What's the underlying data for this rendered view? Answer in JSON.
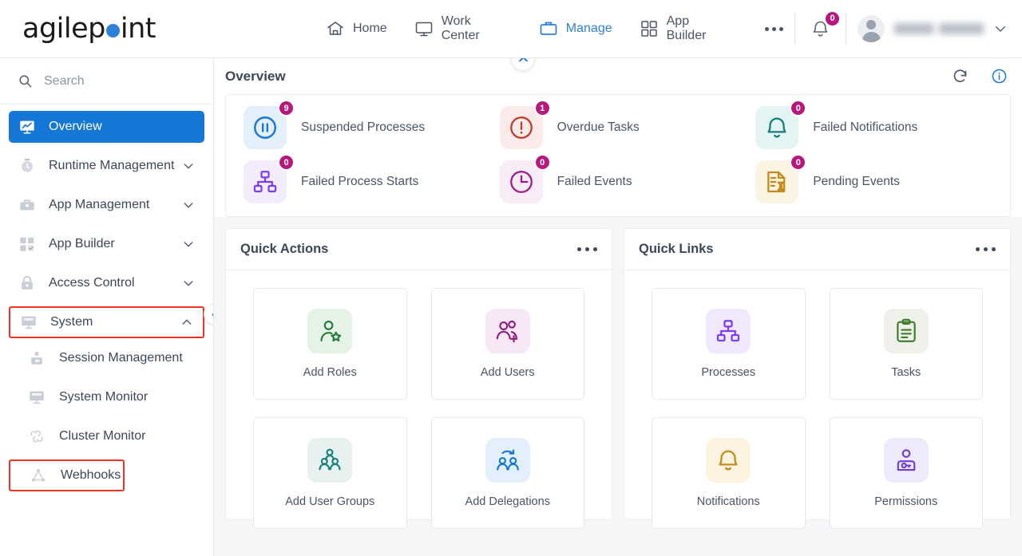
{
  "brand": {
    "name": "agilepoint",
    "dot_color": "#2f80d8"
  },
  "header": {
    "nav": [
      {
        "label": "Home",
        "icon": "home-icon",
        "active": false
      },
      {
        "label": "Work Center",
        "icon": "monitor-icon",
        "active": false
      },
      {
        "label": "Manage",
        "icon": "briefcase-icon",
        "active": true
      },
      {
        "label": "App Builder",
        "icon": "grid-icon",
        "active": false
      }
    ],
    "more_label": "...",
    "notifications": {
      "icon": "bell-icon",
      "count": "0",
      "badge_color": "#b5197c"
    },
    "user": {
      "name": "",
      "avatar": "user-avatar",
      "chevron": "chevron-down-icon"
    }
  },
  "sidebar": {
    "search": {
      "placeholder": "Search",
      "value": "",
      "icon": "search-icon"
    },
    "items": [
      {
        "label": "Overview",
        "icon": "overview-chart-icon",
        "state": "active",
        "expandable": false
      },
      {
        "label": "Runtime Management",
        "icon": "clock-icon",
        "state": "normal",
        "expandable": true,
        "chevron": "chevron-down-icon"
      },
      {
        "label": "App Management",
        "icon": "toolbox-icon",
        "state": "normal",
        "expandable": true,
        "chevron": "chevron-down-icon"
      },
      {
        "label": "App Builder",
        "icon": "grid-check-icon",
        "state": "normal",
        "expandable": true,
        "chevron": "chevron-down-icon"
      },
      {
        "label": "Access Control",
        "icon": "lock-icon",
        "state": "normal",
        "expandable": true,
        "chevron": "chevron-down-icon"
      },
      {
        "label": "System",
        "icon": "server-monitor-icon",
        "state": "highlighted",
        "expandable": true,
        "chevron": "chevron-up-icon"
      }
    ],
    "sub_items": [
      {
        "label": "Session Management",
        "icon": "user-session-icon",
        "highlighted": false
      },
      {
        "label": "System Monitor",
        "icon": "server-monitor-icon",
        "highlighted": false
      },
      {
        "label": "Cluster Monitor",
        "icon": "cluster-icon",
        "highlighted": false
      },
      {
        "label": "Webhooks",
        "icon": "webhook-icon",
        "highlighted": true
      }
    ],
    "highlight_color": "#ee3224",
    "collapse_handle": "chevron-left-icon"
  },
  "overview": {
    "title": "Overview",
    "collapse_icon": "chevron-up-icon",
    "refresh_icon": "refresh-icon",
    "info_icon": "info-icon",
    "stats": [
      {
        "label": "Suspended Processes",
        "count": "9",
        "icon": "pause-circle-icon",
        "color": "#1678d6",
        "bg": "#e3f0fc"
      },
      {
        "label": "Overdue Tasks",
        "count": "1",
        "icon": "alert-circle-icon",
        "color": "#c0392b",
        "bg": "#fbeaea"
      },
      {
        "label": "Failed Notifications",
        "count": "0",
        "icon": "bell-icon",
        "color": "#147d7d",
        "bg": "#e3f4f2"
      },
      {
        "label": "Failed Process Starts",
        "count": "0",
        "icon": "hierarchy-icon",
        "color": "#7b3ff2",
        "bg": "#f2ecfd"
      },
      {
        "label": "Failed Events",
        "count": "0",
        "icon": "clock-circle-icon",
        "color": "#a01a8d",
        "bg": "#f8ecf6"
      },
      {
        "label": "Pending Events",
        "count": "0",
        "icon": "pending-doc-icon",
        "color": "#c58a1a",
        "bg": "#fcf4e3"
      }
    ]
  },
  "quick_actions": {
    "title": "Quick Actions",
    "menu_icon": "more-dots-icon",
    "tiles": [
      {
        "label": "Add Roles",
        "icon": "user-star-icon",
        "color": "#237a3c",
        "bg": "#e4f3e6"
      },
      {
        "label": "Add Users",
        "icon": "user-plus-icon",
        "color": "#8e1b7d",
        "bg": "#f8e8f6"
      },
      {
        "label": "Add User Groups",
        "icon": "user-group-icon",
        "color": "#18817c",
        "bg": "#e6f1f0"
      },
      {
        "label": "Add Delegations",
        "icon": "delegation-icon",
        "color": "#1678d6",
        "bg": "#e3f0fc"
      }
    ]
  },
  "quick_links": {
    "title": "Quick Links",
    "menu_icon": "more-dots-icon",
    "tiles": [
      {
        "label": "Processes",
        "icon": "hierarchy-icon",
        "color": "#7b3ff2",
        "bg": "#f0e9fe"
      },
      {
        "label": "Tasks",
        "icon": "clipboard-icon",
        "color": "#3d7a28",
        "bg": "#eef1e9"
      },
      {
        "label": "Notifications",
        "icon": "bell-icon",
        "color": "#c58a1a",
        "bg": "#fcf3e0"
      },
      {
        "label": "Permissions",
        "icon": "user-key-icon",
        "color": "#6b3fd4",
        "bg": "#efe9fc"
      }
    ]
  }
}
